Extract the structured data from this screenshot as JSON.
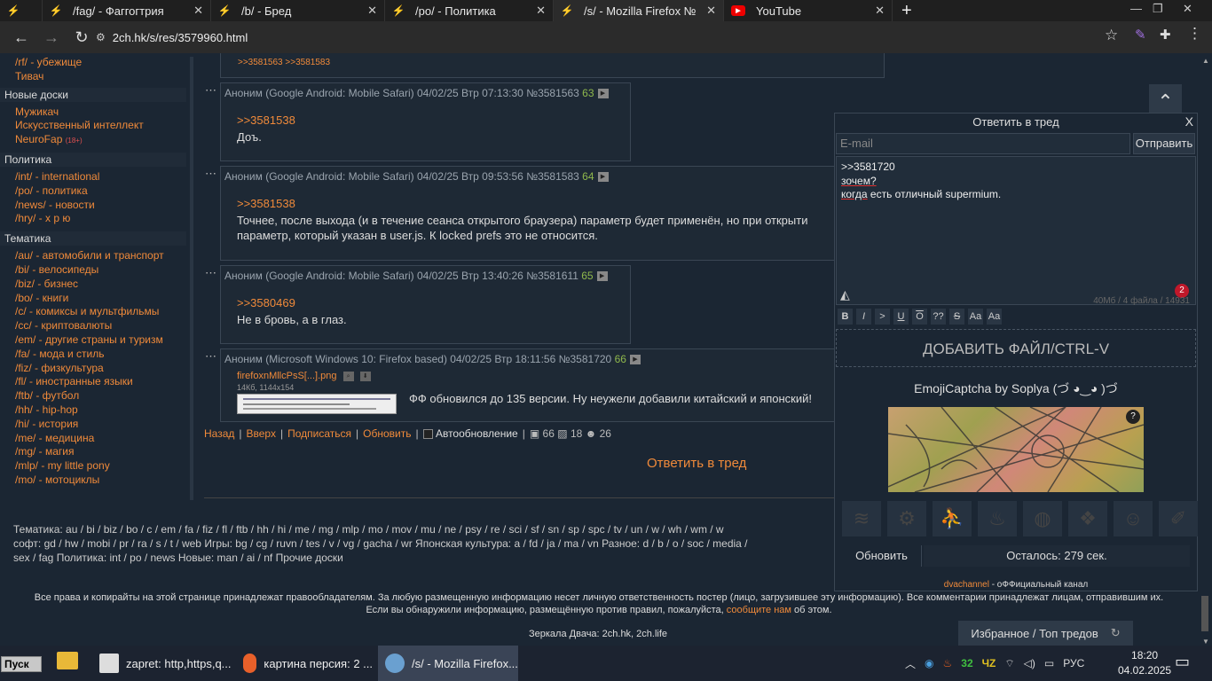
{
  "tabs": [
    {
      "label": "",
      "icon": "bolt-icon"
    },
    {
      "label": "/fag/ - Фаггогтрия"
    },
    {
      "label": "/b/ - Бред"
    },
    {
      "label": "/po/ - Политика"
    },
    {
      "label": "/s/ - Mozilla Firefox №"
    },
    {
      "label": "YouTube"
    }
  ],
  "window": {
    "minimize": "—",
    "restore": "❐",
    "close": "✕"
  },
  "url": "2ch.hk/s/res/3579960.html",
  "sidebar": {
    "top_items": [
      "/rf/ - убежище",
      "Тивач"
    ],
    "sections": [
      {
        "title": "Новые доски",
        "items": [
          "Мужикач",
          "Искусственный интеллект",
          "NeuroFap"
        ]
      },
      {
        "title": "Политика",
        "items": [
          "/int/ - international",
          "/po/ - политика",
          "/news/ - новости",
          "/hry/ - х р ю"
        ]
      },
      {
        "title": "Тематика",
        "items": [
          "/au/ - автомобили и транспорт",
          "/bi/ - велосипеды",
          "/biz/ - бизнес",
          "/bo/ - книги",
          "/c/ - комиксы и мультфильмы",
          "/cc/ - криптовалюты",
          "/em/ - другие страны и туризм",
          "/fa/ - мода и стиль",
          "/fiz/ - физкультура",
          "/fl/ - иностранные языки",
          "/ftb/ - футбол",
          "/hh/ - hip-hop",
          "/hi/ - история",
          "/me/ - медицина",
          "/mg/ - магия",
          "/mlp/ - my little pony",
          "/mo/ - мотоциклы"
        ]
      }
    ],
    "neurofap_tag": "(18+)"
  },
  "prev_post_links": ">>3581563 >>3581583",
  "posts": [
    {
      "author": "Аноним (Google Android: Mobile Safari)",
      "date": "04/02/25 Втр 07:13:30",
      "num": "№3581563",
      "count": "63",
      "reply": ">>3581538",
      "text": "Доъ."
    },
    {
      "author": "Аноним (Google Android: Mobile Safari)",
      "date": "04/02/25 Втр 09:53:56",
      "num": "№3581583",
      "count": "64",
      "reply": ">>3581538",
      "text": "Точнее, после выхода (и в течение сеанса открытого браузера) параметр будет применён, но при открыти",
      "text2": "параметр, который указан в user.js. К locked prefs это не относится."
    },
    {
      "author": "Аноним (Google Android: Mobile Safari)",
      "date": "04/02/25 Втр 13:40:26",
      "num": "№3581611",
      "count": "65",
      "reply": ">>3580469",
      "text": "Не в бровь, а в глаз."
    },
    {
      "author": "Аноним (Microsoft Windows 10: Firefox based)",
      "date": "04/02/25 Втр 18:11:56",
      "num": "№3581720",
      "count": "66",
      "file": "firefoxnMllcPsS[...].png",
      "fileinfo": "14Кб, 1144x154",
      "text": "ФФ обновился до 135 версии. Ну неужели добавили китайский и японский!"
    }
  ],
  "bottom_nav": {
    "back": "Назад",
    "top": "Вверх",
    "subscribe": "Подписаться",
    "update": "Обновить",
    "autoupdate": "Автообновление",
    "posts": "66",
    "images": "18",
    "users": "26"
  },
  "reply_thread": "Ответить в тред",
  "boards_footer": {
    "line1": "Тематика: au / bi / biz / bo / c / em / fa / fiz / fl / ftb / hh / hi / me / mg / mlp / mo / mov / mu / ne / psy / re / sci / sf / sn / sp / spc / tv / un / w / wh / wm / w",
    "line2": "софт: gd / hw / mobi / pr / ra / s / t / web Игры: bg / cg / ruvn / tes / v / vg / gacha / wr Японская культура: a / fd / ja / ma / vn Разное: d / b / o / soc / media /",
    "line3": "sex / fag Политика: int / po / news Новые: man / ai / nf  Прочие доски"
  },
  "copyright": "Все права и копирайты на этой странице принадлежат правообладателям. За любую размещенную информацию несет личную ответственность постер (лицо, загрузившее эту информацию). Все комментарии принадлежат лицам, отправившим их.",
  "copyright2_pre": "Если вы обнаружили информацию, размещённую против правил, пожалуйста,",
  "copyright2_link": "сообщите нам",
  "copyright2_post": "об этом.",
  "mirrors": "Зеркала Двача: 2ch.hk, 2ch.life",
  "favorites": "Избранное / Топ тредов",
  "panel": {
    "title": "Ответить в тред",
    "close": "X",
    "email_placeholder": "E-mail",
    "send": "Отправить",
    "text_line1": ">>3581720",
    "text_line2": "зочем?",
    "text_line3a": "когда",
    "text_line3b": " есть отличный supermium.",
    "stats": "40Мб / 4 файла / 14931",
    "badge": "2",
    "format": [
      "B",
      "I",
      ">",
      "U",
      "O",
      "??",
      "S",
      "Aa",
      "Aa"
    ],
    "dropzone": "ДОБАВИТЬ ФАЙЛ/CTRL-V",
    "captcha_title": "EmojiCaptcha by Soplya (づ ◕‿◕ )づ",
    "captcha_help": "?",
    "emoji_icons": [
      "wifi-icon",
      "motorcycle-icon",
      "cyclist-icon",
      "bathtub-icon",
      "ball-icon",
      "pineapple-icon",
      "person-icon",
      "brush-icon"
    ],
    "refresh": "Обновить",
    "remaining": "Осталось: 279 сек.",
    "channel_link": "dvachannel",
    "channel_text": " - оФФициальный канал"
  },
  "taskbar": {
    "start": "Пуск",
    "items": [
      "zapret: http,https,q...",
      "картина персия: 2 ...",
      "/s/ - Mozilla Firefox..."
    ],
    "tray_nums": [
      "32",
      "ЧZ"
    ],
    "lang": "РУС",
    "time": "18:20",
    "date": "04.02.2025"
  },
  "colors": {
    "accent": "#f08a3a",
    "bg": "#1b2633",
    "post_count": "#8fb84c"
  }
}
